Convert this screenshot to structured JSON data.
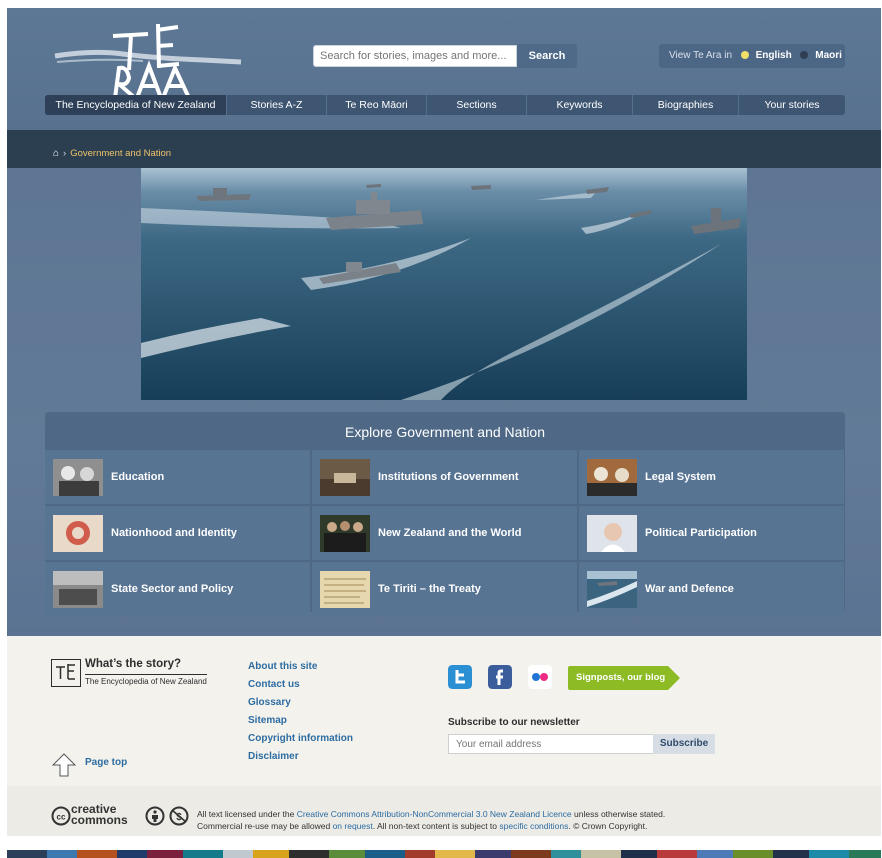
{
  "header": {
    "search_placeholder": "Search for stories, images and more...",
    "search_button": "Search",
    "lang_label": "View Te Ara in",
    "lang_english": "English",
    "lang_maori": "Maori"
  },
  "nav": [
    {
      "label": "The Encyclopedia of New Zealand"
    },
    {
      "label": "Stories A-Z"
    },
    {
      "label": "Te Reo Māori"
    },
    {
      "label": "Sections"
    },
    {
      "label": "Keywords"
    },
    {
      "label": "Biographies"
    },
    {
      "label": "Your stories"
    }
  ],
  "breadcrumb": {
    "current": "Government and Nation"
  },
  "explore": {
    "title": "Explore Government and Nation",
    "tiles": [
      {
        "label": "Education"
      },
      {
        "label": "Institutions of Government"
      },
      {
        "label": "Legal System"
      },
      {
        "label": "Nationhood and Identity"
      },
      {
        "label": "New Zealand and the World"
      },
      {
        "label": "Political Participation"
      },
      {
        "label": "State Sector and Policy"
      },
      {
        "label": "Te Tiriti – the Treaty"
      },
      {
        "label": "War and Defence"
      }
    ]
  },
  "footer": {
    "logo_title": "What’s the story?",
    "logo_sub": "The Encyclopedia of New Zealand",
    "links": [
      "About this site",
      "Contact us",
      "Glossary",
      "Sitemap",
      "Copyright information",
      "Disclaimer"
    ],
    "page_top": "Page top",
    "signposts": "Signposts, our blog",
    "newsletter_label": "Subscribe to our newsletter",
    "email_placeholder": "Your email address",
    "subscribe_button": "Subscribe",
    "licence_1": "All text licensed under the ",
    "licence_link": "Creative Commons Attribution-NonCommercial 3.0 New Zealand Licence",
    "licence_2": " unless otherwise stated.",
    "licence_3": "Commercial re-use may be allowed ",
    "licence_link2": "on request",
    "licence_4": ". All non-text content is subject to ",
    "licence_link3": "specific conditions",
    "licence_5": ". © Crown Copyright.",
    "cc_text": "creative commons"
  },
  "colors": {
    "header_bg": "#5d7895",
    "nav_bg": "#3f5672",
    "crumb_bg": "#2c3f51",
    "crumb_text": "#f0c36a",
    "link": "#2d6ca1",
    "blog_green": "#8cbb23"
  }
}
